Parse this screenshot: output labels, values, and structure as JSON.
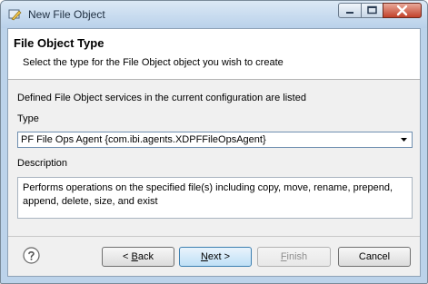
{
  "window": {
    "title": "New File Object",
    "icon": "file-object-wizard-icon",
    "controls": [
      "minimize-icon",
      "maximize-icon",
      "close-icon"
    ]
  },
  "banner": {
    "title": "File Object Type",
    "message": "Select the type for the File Object object you wish to create"
  },
  "form": {
    "intro": "Defined File Object services in the current configuration are listed",
    "type_label": "Type",
    "type_value": "PF File Ops Agent {com.ibi.agents.XDPFFileOpsAgent}",
    "description_label": "Description",
    "description_text": "Performs operations on the specified file(s) including copy, move, rename, prepend, append, delete, size, and exist"
  },
  "buttons": {
    "help_icon": "help-icon",
    "back_prefix": "< ",
    "back_mnemonic": "B",
    "back_rest": "ack",
    "next_mnemonic": "N",
    "next_rest": "ext >",
    "finish_mnemonic": "F",
    "finish_rest": "inish",
    "cancel": "Cancel"
  }
}
